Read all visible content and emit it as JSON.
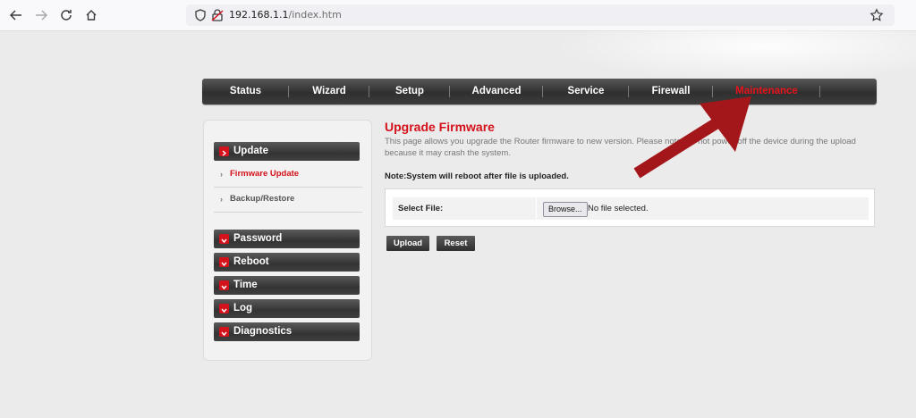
{
  "browser": {
    "url_host": "192.168.1.1",
    "url_path": "/index.htm"
  },
  "main_nav": {
    "items": [
      {
        "label": "Status"
      },
      {
        "label": "Wizard"
      },
      {
        "label": "Setup"
      },
      {
        "label": "Advanced"
      },
      {
        "label": "Service"
      },
      {
        "label": "Firewall"
      },
      {
        "label": "Maintenance"
      }
    ],
    "active": "Maintenance"
  },
  "sidebar": {
    "sections": [
      {
        "label": "Update"
      },
      {
        "label": "Password"
      },
      {
        "label": "Reboot"
      },
      {
        "label": "Time"
      },
      {
        "label": "Log"
      },
      {
        "label": "Diagnostics"
      }
    ],
    "update_subitems": [
      {
        "label": "Firmware Update"
      },
      {
        "label": "Backup/Restore"
      }
    ]
  },
  "content": {
    "title": "Upgrade Firmware",
    "description": "This page allows you upgrade the Router firmware to new version. Please note, do not power off the device during the upload because it may crash the system.",
    "note": "Note:System will reboot after file is uploaded.",
    "select_file_label": "Select File:",
    "browse_label": "Browse...",
    "file_status": "No file selected.",
    "upload_label": "Upload",
    "reset_label": "Reset"
  },
  "colors": {
    "accent_red": "#d4121b",
    "nav_dark": "#333333",
    "background": "#ebebeb"
  }
}
